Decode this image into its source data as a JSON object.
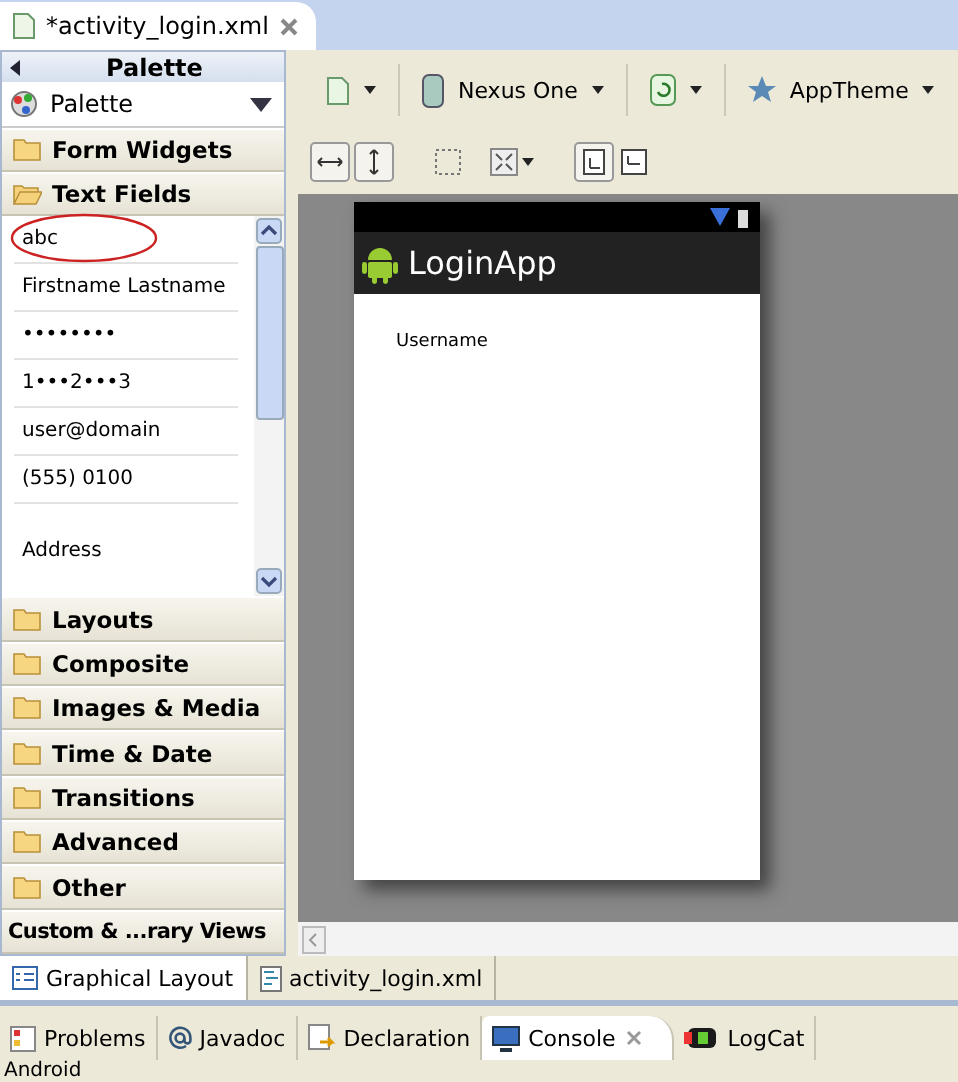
{
  "editor_tab": {
    "title": "*activity_login.xml"
  },
  "palette": {
    "title": "Palette",
    "dropdown": "Palette",
    "categories": [
      {
        "label": "Form Widgets",
        "expanded": false
      },
      {
        "label": "Text Fields",
        "expanded": true,
        "items": [
          {
            "label": "abc",
            "circled": true
          },
          {
            "label": "Firstname Lastname",
            "circled": false
          },
          {
            "label": "••••••••",
            "circled": false
          },
          {
            "label": "1•••2•••3",
            "circled": false
          },
          {
            "label": "user@domain",
            "circled": false
          },
          {
            "label": "(555) 0100",
            "circled": false
          },
          {
            "label": "Address",
            "circled": false
          }
        ]
      },
      {
        "label": "Layouts",
        "expanded": false
      },
      {
        "label": "Composite",
        "expanded": false
      },
      {
        "label": "Images & Media",
        "expanded": false
      },
      {
        "label": "Time & Date",
        "expanded": false
      },
      {
        "label": "Transitions",
        "expanded": false
      },
      {
        "label": "Advanced",
        "expanded": false
      },
      {
        "label": "Other",
        "expanded": false
      }
    ],
    "custom": "Custom & ...rary Views"
  },
  "toolbar": {
    "device": "Nexus One",
    "theme": "AppTheme"
  },
  "phone": {
    "app_title": "LoginApp",
    "label": "Username"
  },
  "editor_tabs": [
    {
      "label": "Graphical Layout",
      "selected": true
    },
    {
      "label": "activity_login.xml",
      "selected": false
    }
  ],
  "view_tabs": [
    {
      "label": "Problems",
      "selected": false
    },
    {
      "label": "Javadoc",
      "selected": false
    },
    {
      "label": "Declaration",
      "selected": false
    },
    {
      "label": "Console",
      "selected": true
    },
    {
      "label": "LogCat",
      "selected": false
    }
  ],
  "status_bar": "Android"
}
